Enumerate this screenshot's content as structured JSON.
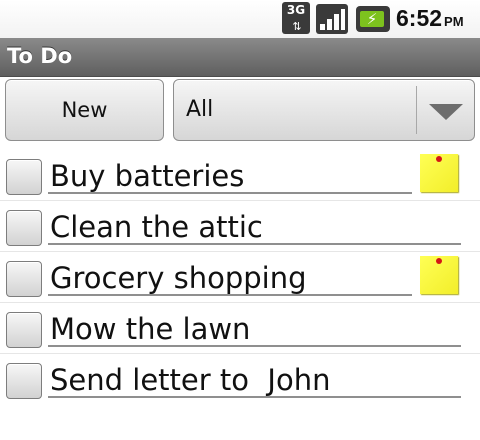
{
  "status_bar": {
    "network_type": "3G",
    "network_arrows": "⇅",
    "time": "6:52",
    "ampm": "PM",
    "signal_level": 1.0,
    "battery_charging": true,
    "battery_icon_glyph": "⚡",
    "icons": [
      "network-3g-icon",
      "signal-strength-icon",
      "battery-charging-icon"
    ]
  },
  "app": {
    "title": "To Do"
  },
  "toolbar": {
    "new_label": "New",
    "filter_value": "All"
  },
  "todos": [
    {
      "text": "Buy batteries",
      "checked": false,
      "has_note": true
    },
    {
      "text": "Clean the attic",
      "checked": false,
      "has_note": false
    },
    {
      "text": "Grocery shopping",
      "checked": false,
      "has_note": true
    },
    {
      "text": "Mow the lawn",
      "checked": false,
      "has_note": false
    },
    {
      "text": "Send letter to  John",
      "checked": false,
      "has_note": false
    }
  ],
  "colors": {
    "title_bar": "#6f6f6f",
    "note": "#ffff44",
    "note_pin": "#d41616",
    "battery": "#7dc21e"
  }
}
